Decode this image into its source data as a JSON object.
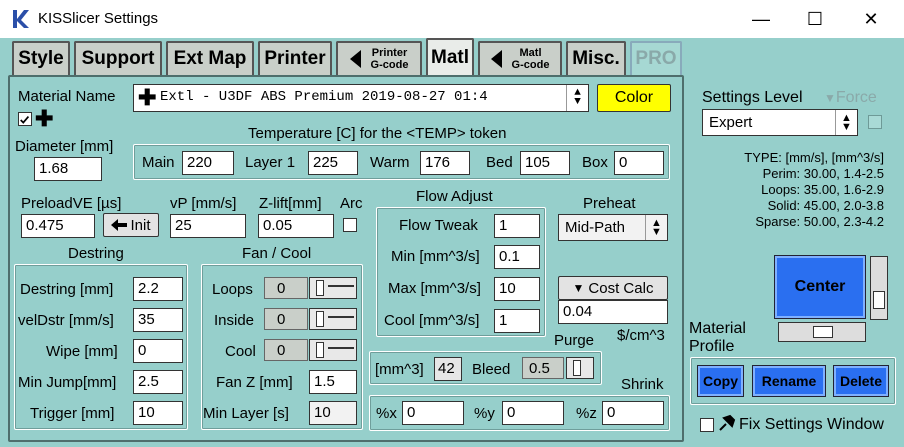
{
  "window": {
    "title": "KISSlicer Settings",
    "min": "—",
    "max": "☐",
    "close": "✕"
  },
  "tabs": {
    "style": "Style",
    "support": "Support",
    "extmap": "Ext Map",
    "printer": "Printer",
    "printer_gcode_l1": "Printer",
    "printer_gcode_l2": "G-code",
    "matl": "Matl",
    "matl_gcode_l1": "Matl",
    "matl_gcode_l2": "G-code",
    "misc": "Misc.",
    "pro": "PRO"
  },
  "material": {
    "name_label": "Material Name",
    "name_value": "Extl - U3DF ABS Premium  2019-08-27 01:4",
    "color_button": "Color",
    "plus": "✚",
    "diameter_label": "Diameter [mm]",
    "diameter_value": "1.68"
  },
  "temperature": {
    "title": "Temperature [C] for the <TEMP> token",
    "main_label": "Main",
    "main_value": "220",
    "layer1_label": "Layer 1",
    "layer1_value": "225",
    "warm_label": "Warm",
    "warm_value": "176",
    "bed_label": "Bed",
    "bed_value": "105",
    "box_label": "Box",
    "box_value": "0"
  },
  "preload": {
    "label": "PreloadVE [µs]",
    "value": "0.475",
    "init_button": "Init",
    "vp_label": "vP [mm/s]",
    "vp_value": "25",
    "zlift_label": "Z-lift[mm]",
    "zlift_value": "0.05",
    "arc_label": "Arc"
  },
  "flow": {
    "title": "Flow Adjust",
    "tweak_label": "Flow Tweak",
    "tweak_value": "1",
    "min_label": "Min [mm^3/s]",
    "min_value": "0.1",
    "max_label": "Max [mm^3/s]",
    "max_value": "10",
    "cool_label": "Cool [mm^3/s]",
    "cool_value": "1"
  },
  "preheat": {
    "title": "Preheat",
    "value": "Mid-Path"
  },
  "cost": {
    "button": "Cost Calc",
    "value": "0.04",
    "unit": "$/cm^3"
  },
  "destring": {
    "title": "Destring",
    "destring_label": "Destring [mm]",
    "destring_value": "2.2",
    "veldstr_label": "velDstr [mm/s]",
    "veldstr_value": "35",
    "wipe_label": "Wipe [mm]",
    "wipe_value": "0",
    "minjump_label": "Min Jump[mm]",
    "minjump_value": "2.5",
    "trigger_label": "Trigger [mm]",
    "trigger_value": "10"
  },
  "fan": {
    "title": "Fan / Cool",
    "loops_label": "Loops",
    "loops_value": "0",
    "inside_label": "Inside",
    "inside_value": "0",
    "cool_label": "Cool",
    "cool_value": "0",
    "fanz_label": "Fan Z [mm]",
    "fanz_value": "1.5",
    "minlayer_label": "Min Layer [s]",
    "minlayer_value": "10"
  },
  "purge": {
    "title": "Purge",
    "mm3_label": "[mm^3]",
    "mm3_value": "42",
    "bleed_label": "Bleed",
    "bleed_value": "0.5"
  },
  "shrink": {
    "title": "Shrink",
    "x_label": "%x",
    "x_value": "0",
    "y_label": "%y",
    "y_value": "0",
    "z_label": "%z",
    "z_value": "0"
  },
  "settings": {
    "level_label": "Settings Level",
    "force_label": "Force",
    "level_value": "Expert"
  },
  "typeinfo": {
    "header": "TYPE: [mm/s], [mm^3/s]",
    "perim": "Perim:   30.00,  1.4-2.5",
    "loops": "Loops:   35.00,  1.6-2.9",
    "solid": "Solid:   45.00,  2.0-3.8",
    "sparse": "Sparse:   50.00,  2.3-4.2"
  },
  "profile": {
    "center_button": "Center",
    "label_l1": "Material",
    "label_l2": "Profile",
    "copy": "Copy",
    "rename": "Rename",
    "delete": "Delete",
    "fix_label": "Fix Settings Window"
  }
}
